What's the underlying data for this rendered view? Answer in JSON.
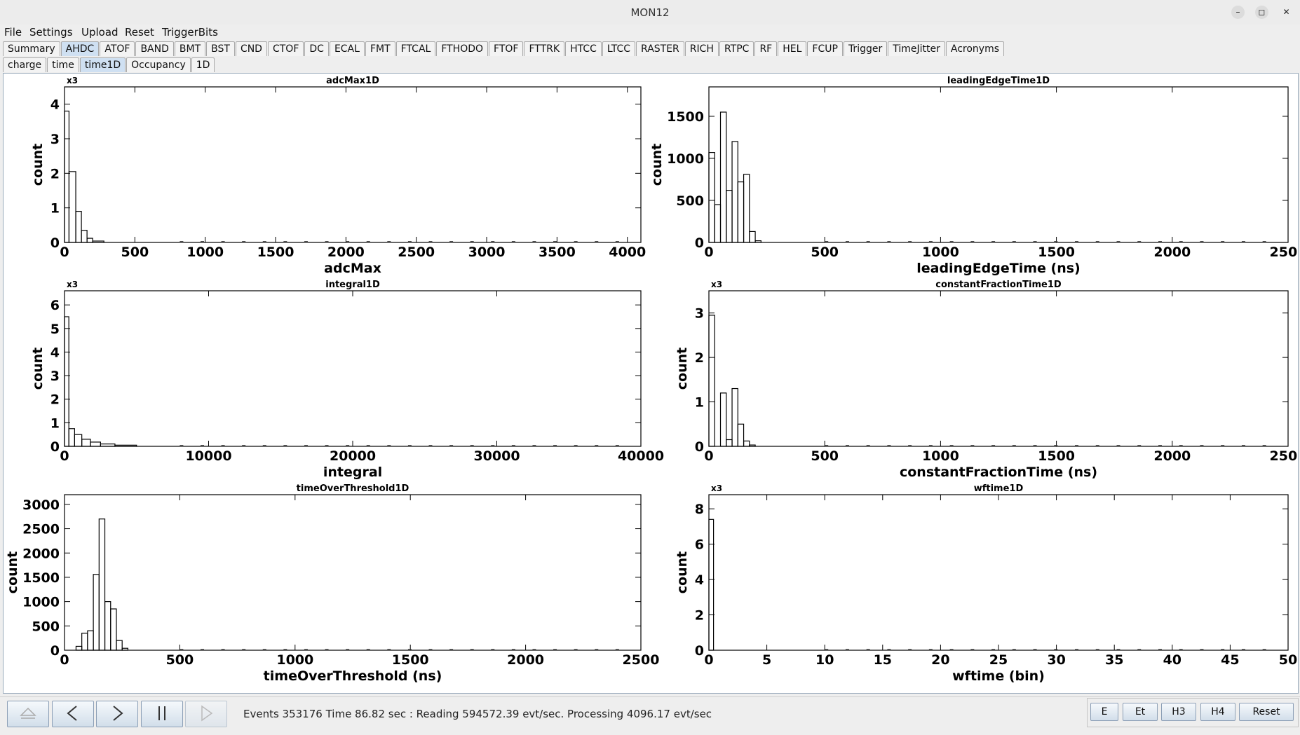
{
  "window": {
    "title": "MON12"
  },
  "menu": [
    "File",
    "Settings",
    "Upload",
    "Reset",
    "TriggerBits"
  ],
  "detector_tabs": [
    "Summary",
    "AHDC",
    "ATOF",
    "BAND",
    "BMT",
    "BST",
    "CND",
    "CTOF",
    "DC",
    "ECAL",
    "FMT",
    "FTCAL",
    "FTHODO",
    "FTOF",
    "FTTRK",
    "HTCC",
    "LTCC",
    "RASTER",
    "RICH",
    "RTPC",
    "RF",
    "HEL",
    "FCUP",
    "Trigger",
    "TimeJitter",
    "Acronyms"
  ],
  "active_detector_tab": "AHDC",
  "sub_tabs": [
    "charge",
    "time",
    "time1D",
    "Occupancy",
    "1D"
  ],
  "active_sub_tab": "time1D",
  "status": {
    "text": "Events 353176  Time 86.82 sec : Reading 594572.39  evt/sec. Processing 4096.17 evt/sec"
  },
  "right_buttons": [
    "E",
    "Et",
    "H3",
    "H4",
    "Reset"
  ],
  "chart_data": [
    {
      "type": "bar",
      "title": "adcMax1D",
      "multiplier": "x3",
      "xlabel": "adcMax",
      "ylabel": "count",
      "xlim": [
        0,
        4096
      ],
      "ylim": [
        0,
        4.5
      ],
      "xticks": [
        "0",
        "500",
        "1000",
        "1500",
        "2000",
        "2500",
        "3000",
        "3500",
        "4000"
      ],
      "yticks": [
        "0",
        "1",
        "2",
        "3",
        "4"
      ],
      "bins": [
        [
          0,
          32,
          3.8
        ],
        [
          32,
          80,
          2.05
        ],
        [
          80,
          120,
          0.9
        ],
        [
          120,
          160,
          0.35
        ],
        [
          160,
          200,
          0.12
        ],
        [
          200,
          280,
          0.04
        ],
        [
          280,
          4096,
          0.0
        ]
      ]
    },
    {
      "type": "bar",
      "title": "leadingEdgeTime1D",
      "multiplier": "",
      "xlabel": "leadingEdgeTime (ns)",
      "ylabel": "count",
      "xlim": [
        0,
        2500
      ],
      "ylim": [
        0,
        1850
      ],
      "xticks": [
        "0",
        "500",
        "1000",
        "1500",
        "2000",
        "2500"
      ],
      "yticks": [
        "0",
        "500",
        "1000",
        "1500"
      ],
      "bins": [
        [
          0,
          25,
          1070
        ],
        [
          25,
          50,
          450
        ],
        [
          50,
          75,
          1550
        ],
        [
          75,
          100,
          620
        ],
        [
          100,
          125,
          1200
        ],
        [
          125,
          150,
          720
        ],
        [
          150,
          175,
          810
        ],
        [
          175,
          200,
          130
        ],
        [
          200,
          225,
          20
        ],
        [
          225,
          2500,
          0
        ]
      ]
    },
    {
      "type": "bar",
      "title": "integral1D",
      "multiplier": "x3",
      "xlabel": "integral",
      "ylabel": "count",
      "xlim": [
        0,
        40000
      ],
      "ylim": [
        0,
        6.6
      ],
      "xticks": [
        "0",
        "10000",
        "20000",
        "30000",
        "40000"
      ],
      "yticks": [
        "0",
        "1",
        "2",
        "3",
        "4",
        "5",
        "6"
      ],
      "bins": [
        [
          0,
          300,
          5.5
        ],
        [
          300,
          700,
          0.75
        ],
        [
          700,
          1200,
          0.5
        ],
        [
          1200,
          1800,
          0.3
        ],
        [
          1800,
          2500,
          0.18
        ],
        [
          2500,
          3500,
          0.1
        ],
        [
          3500,
          5000,
          0.05
        ],
        [
          5000,
          40000,
          0.0
        ]
      ]
    },
    {
      "type": "bar",
      "title": "constantFractionTime1D",
      "multiplier": "x3",
      "xlabel": "constantFractionTime (ns)",
      "ylabel": "count",
      "xlim": [
        0,
        2500
      ],
      "ylim": [
        0,
        3.5
      ],
      "xticks": [
        "0",
        "500",
        "1000",
        "1500",
        "2000",
        "2500"
      ],
      "yticks": [
        "0",
        "1",
        "2",
        "3"
      ],
      "bins": [
        [
          0,
          25,
          2.95
        ],
        [
          25,
          50,
          0.0
        ],
        [
          50,
          75,
          1.2
        ],
        [
          75,
          100,
          0.15
        ],
        [
          100,
          125,
          1.3
        ],
        [
          125,
          150,
          0.5
        ],
        [
          150,
          175,
          0.12
        ],
        [
          175,
          200,
          0.03
        ],
        [
          200,
          2500,
          0.0
        ]
      ]
    },
    {
      "type": "bar",
      "title": "timeOverThreshold1D",
      "multiplier": "",
      "xlabel": "timeOverThreshold (ns)",
      "ylabel": "count",
      "xlim": [
        0,
        2500
      ],
      "ylim": [
        0,
        3200
      ],
      "xticks": [
        "0",
        "500",
        "1000",
        "1500",
        "2000",
        "2500"
      ],
      "yticks": [
        "0",
        "500",
        "1000",
        "1500",
        "2000",
        "2500",
        "3000"
      ],
      "bins": [
        [
          0,
          50,
          0
        ],
        [
          50,
          75,
          80
        ],
        [
          75,
          100,
          350
        ],
        [
          100,
          125,
          400
        ],
        [
          125,
          150,
          1560
        ],
        [
          150,
          175,
          2700
        ],
        [
          175,
          200,
          1000
        ],
        [
          200,
          225,
          850
        ],
        [
          225,
          250,
          200
        ],
        [
          250,
          275,
          40
        ],
        [
          275,
          2500,
          0
        ]
      ]
    },
    {
      "type": "bar",
      "title": "wftime1D",
      "multiplier": "x3",
      "xlabel": "wftime (bin)",
      "ylabel": "count",
      "xlim": [
        0,
        50
      ],
      "ylim": [
        0,
        8.8
      ],
      "xticks": [
        "0",
        "5",
        "10",
        "15",
        "20",
        "25",
        "30",
        "35",
        "40",
        "45",
        "50"
      ],
      "yticks": [
        "0",
        "2",
        "4",
        "6",
        "8"
      ],
      "bins": [
        [
          0,
          0.4,
          7.4
        ],
        [
          0.4,
          50,
          0.0
        ]
      ]
    }
  ]
}
